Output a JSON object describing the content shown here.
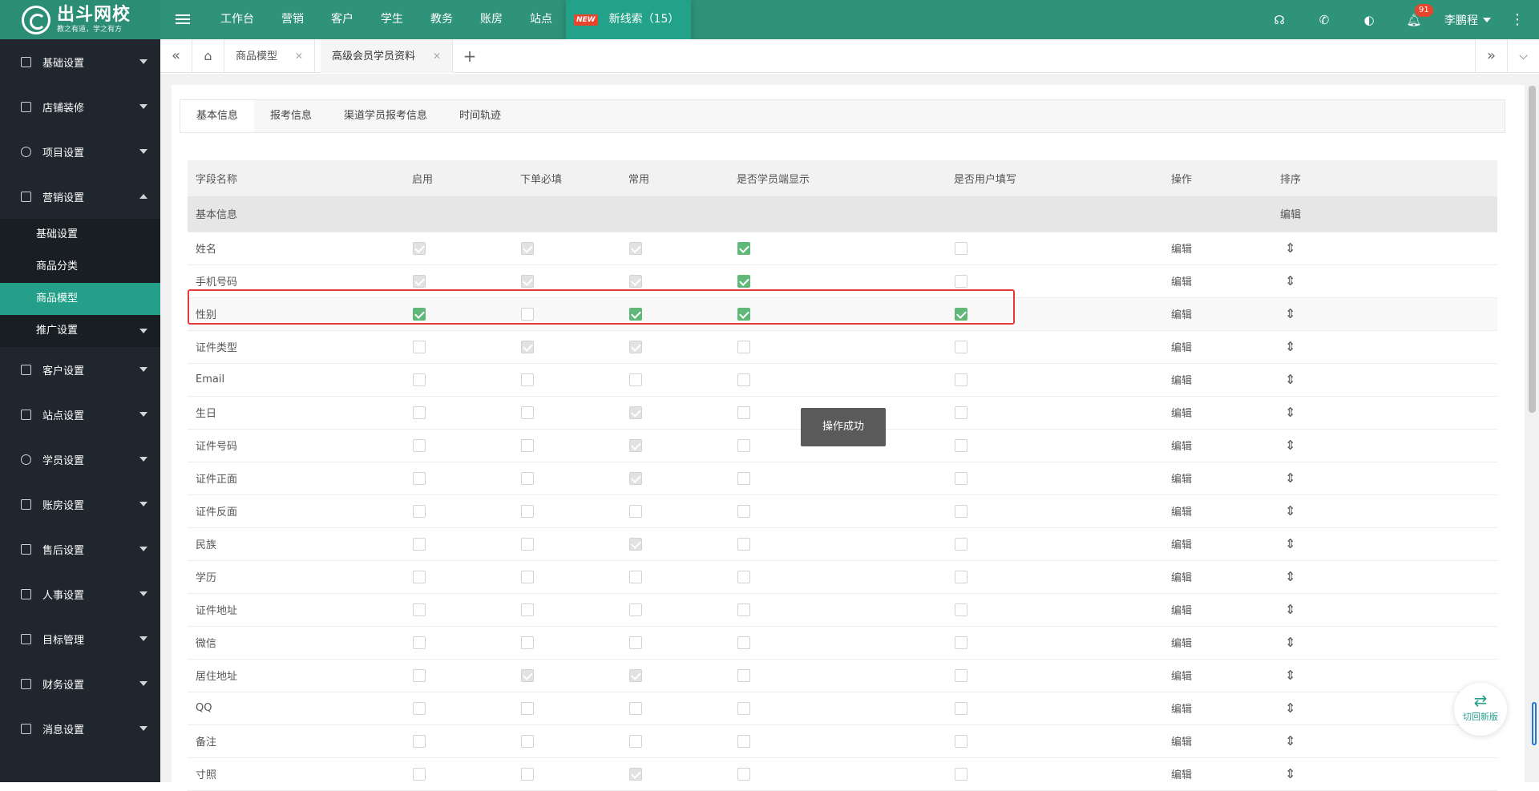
{
  "brand": {
    "title": "出斗网校",
    "subtitle": "教之有道，学之有方"
  },
  "topnav": {
    "items": [
      "工作台",
      "营销",
      "客户",
      "学生",
      "教务",
      "账房",
      "站点"
    ],
    "new_badge": "NEW",
    "new_clue": "新线索（15）"
  },
  "topright": {
    "bell_count": "91",
    "user": "李鹏程"
  },
  "sidebar": {
    "groups_top": [
      "基础设置",
      "店铺装修",
      "项目设置",
      "营销设置"
    ],
    "sub_items": [
      "基础设置",
      "商品分类",
      "商品模型",
      "推广设置"
    ],
    "groups_bottom": [
      "客户设置",
      "站点设置",
      "学员设置",
      "账房设置",
      "售后设置",
      "人事设置",
      "目标管理",
      "财务设置",
      "消息设置"
    ]
  },
  "page_tabs": {
    "tab1": "商品模型",
    "tab2": "高级会员学员资料"
  },
  "inner_tabs": [
    "基本信息",
    "报考信息",
    "渠道学员报考信息",
    "时间轨迹"
  ],
  "table": {
    "headers": [
      "字段名称",
      "启用",
      "下单必填",
      "常用",
      "是否学员端显示",
      "是否用户填写",
      "操作",
      "排序"
    ],
    "group_row": {
      "name": "基本信息",
      "action": "编辑"
    },
    "edit_label": "编辑",
    "rows": [
      {
        "name": "姓名",
        "enable": "dc",
        "required": "dc",
        "common": "dc",
        "show": "c",
        "fill": "u"
      },
      {
        "name": "手机号码",
        "enable": "dc",
        "required": "dc",
        "common": "dc",
        "show": "c",
        "fill": "u"
      },
      {
        "name": "性别",
        "enable": "c",
        "required": "u",
        "common": "c",
        "show": "c",
        "fill": "c"
      },
      {
        "name": "证件类型",
        "enable": "u",
        "required": "dc",
        "common": "dc",
        "show": "u",
        "fill": "u"
      },
      {
        "name": "Email",
        "enable": "u",
        "required": "u",
        "common": "u",
        "show": "u",
        "fill": "u"
      },
      {
        "name": "生日",
        "enable": "u",
        "required": "u",
        "common": "dc",
        "show": "u",
        "fill": "u"
      },
      {
        "name": "证件号码",
        "enable": "u",
        "required": "u",
        "common": "dc",
        "show": "u",
        "fill": "u"
      },
      {
        "name": "证件正面",
        "enable": "u",
        "required": "u",
        "common": "dc",
        "show": "u",
        "fill": "u"
      },
      {
        "name": "证件反面",
        "enable": "u",
        "required": "u",
        "common": "u",
        "show": "u",
        "fill": "u"
      },
      {
        "name": "民族",
        "enable": "u",
        "required": "u",
        "common": "dc",
        "show": "u",
        "fill": "u"
      },
      {
        "name": "学历",
        "enable": "u",
        "required": "u",
        "common": "u",
        "show": "u",
        "fill": "u"
      },
      {
        "name": "证件地址",
        "enable": "u",
        "required": "u",
        "common": "u",
        "show": "u",
        "fill": "u"
      },
      {
        "name": "微信",
        "enable": "u",
        "required": "u",
        "common": "u",
        "show": "u",
        "fill": "u"
      },
      {
        "name": "居住地址",
        "enable": "u",
        "required": "dc",
        "common": "dc",
        "show": "u",
        "fill": "u"
      },
      {
        "name": "QQ",
        "enable": "u",
        "required": "u",
        "common": "u",
        "show": "u",
        "fill": "u"
      },
      {
        "name": "备注",
        "enable": "u",
        "required": "u",
        "common": "u",
        "show": "u",
        "fill": "u"
      },
      {
        "name": "寸照",
        "enable": "u",
        "required": "u",
        "common": "dc",
        "show": "u",
        "fill": "u"
      }
    ]
  },
  "toast": "操作成功",
  "switch_label": "切回新版",
  "colors": {
    "brand": "#2e9378",
    "accent": "#24a08a",
    "sidebar": "#20262d",
    "checked": "#5fb878",
    "highlight_border": "#e53935"
  }
}
